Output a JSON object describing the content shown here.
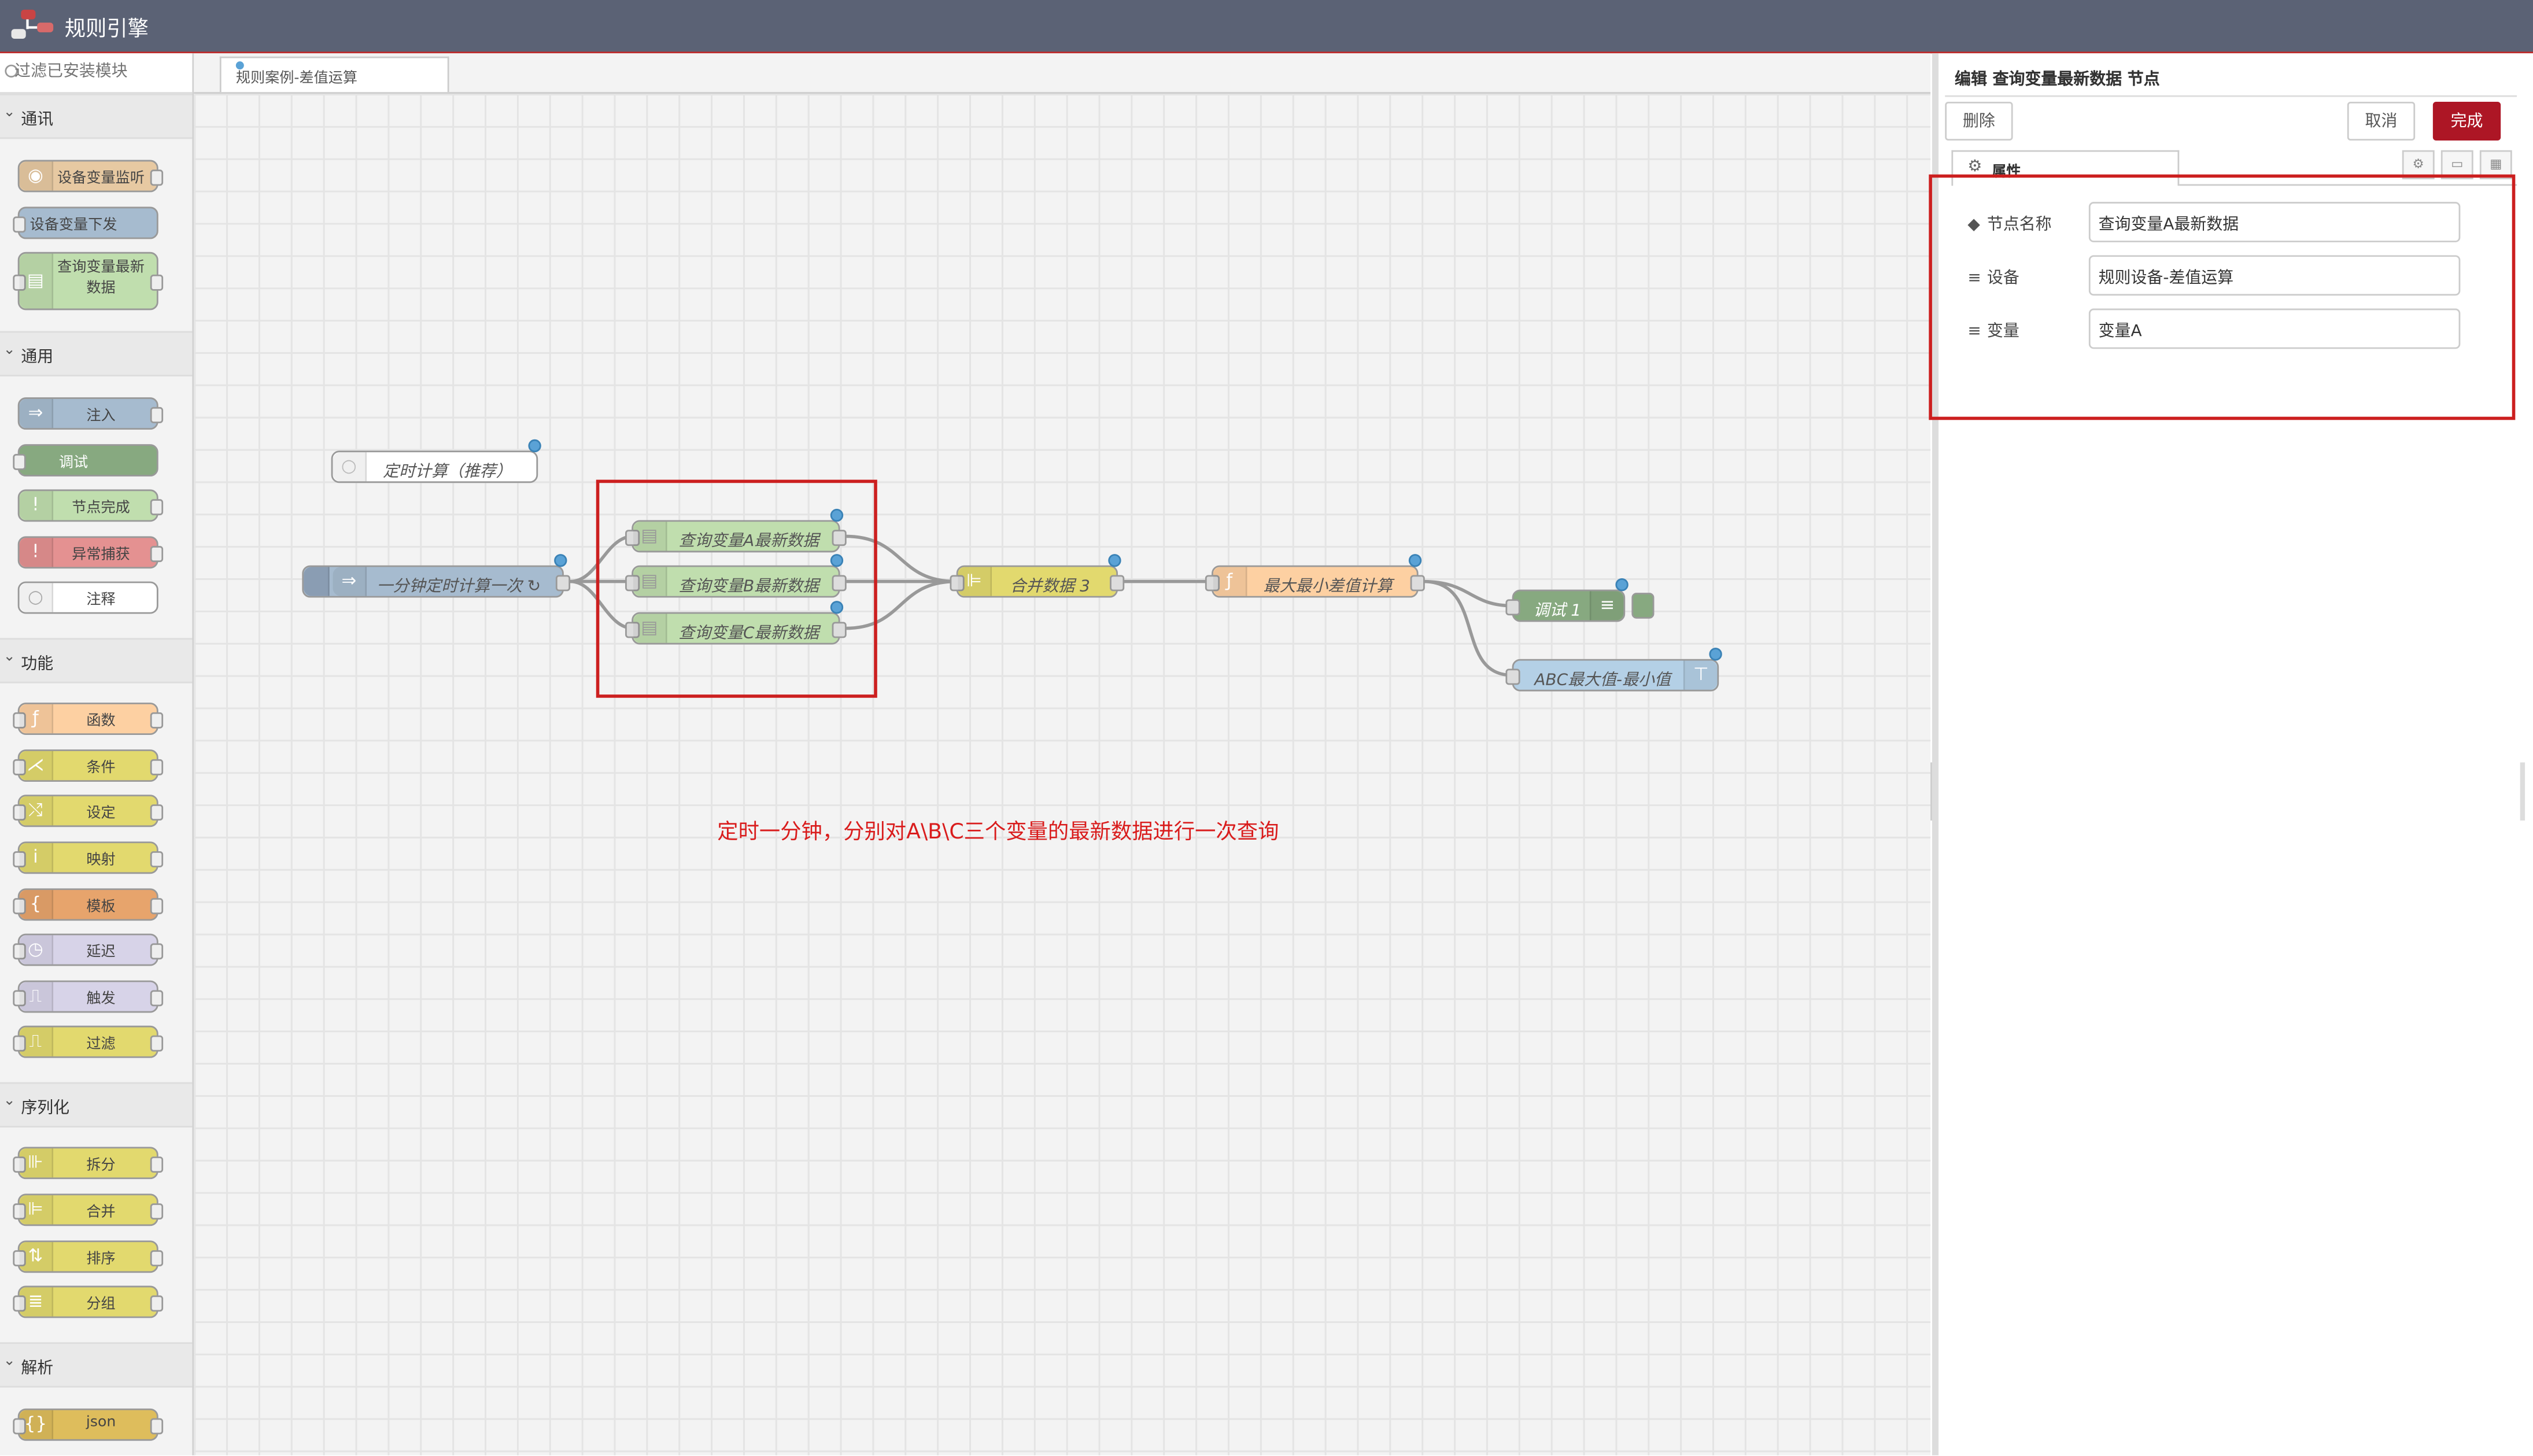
{
  "app": {
    "title": "规则引擎"
  },
  "palette": {
    "search_placeholder": "过滤已安装模块",
    "categories": [
      {
        "label": "通讯",
        "nodes": [
          "设备变量监听",
          "设备变量下发",
          "查询变量最新数据"
        ]
      },
      {
        "label": "通用",
        "nodes": [
          "注入",
          "调试",
          "节点完成",
          "异常捕获",
          "注释"
        ]
      },
      {
        "label": "功能",
        "nodes": [
          "函数",
          "条件",
          "设定",
          "映射",
          "模板",
          "延迟",
          "触发",
          "过滤"
        ]
      },
      {
        "label": "序列化",
        "nodes": [
          "拆分",
          "合并",
          "排序",
          "分组"
        ]
      },
      {
        "label": "解析",
        "nodes": [
          "json"
        ]
      }
    ]
  },
  "workspace": {
    "tab_label": "规则案例-差值运算",
    "nodes": {
      "comment": "定时计算（推荐）",
      "inject": "一分钟定时计算一次 ↻",
      "query_a": "查询变量A最新数据",
      "query_b": "查询变量B最新数据",
      "query_c": "查询变量C最新数据",
      "join": "合并数据 3",
      "function": "最大最小差值计算",
      "debug": "调试 1",
      "output": "ABC最大值-最小值"
    },
    "annotation": "定时一分钟，分别对A\\B\\C三个变量的最新数据进行一次查询"
  },
  "editor": {
    "title": "编辑 查询变量最新数据 节点",
    "delete_label": "删除",
    "cancel_label": "取消",
    "done_label": "完成",
    "properties_tab": "属性",
    "fields": [
      {
        "label": "节点名称",
        "icon": "tag-icon",
        "value": "查询变量A最新数据"
      },
      {
        "label": "设备",
        "icon": "list-icon",
        "value": "规则设备-差值运算"
      },
      {
        "label": "变量",
        "icon": "list-icon",
        "value": "变量A"
      }
    ]
  },
  "colors": {
    "header": "#5b6275",
    "accent_red": "#ad1625",
    "highlight": "#cc1f1f",
    "comm_orange": "#e7c9a2",
    "comm_blue": "#a6bbcf",
    "comm_green": "#c0deae",
    "inject": "#a6bbcf",
    "debug": "#87a980",
    "function": "#fdd0a2",
    "switch": "#e2d96e",
    "catch": "#e49191",
    "output": "#b4d0e6"
  }
}
